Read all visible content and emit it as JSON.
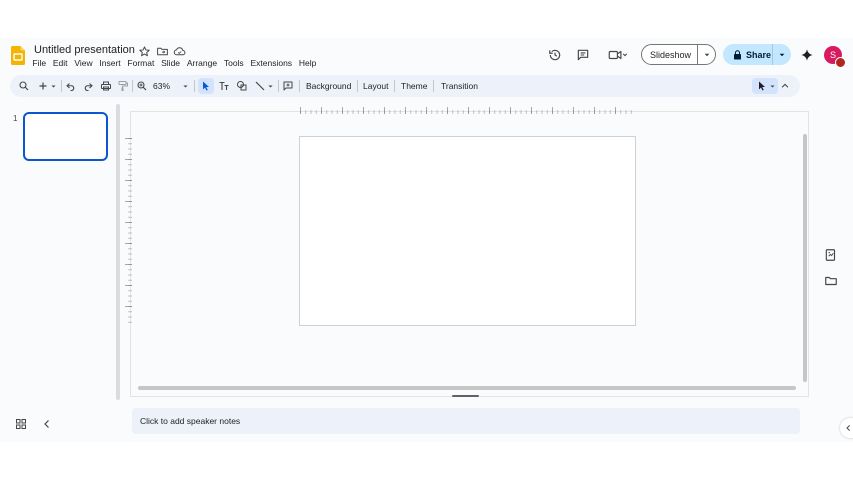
{
  "document": {
    "title": "Untitled presentation"
  },
  "menu": [
    "File",
    "Edit",
    "View",
    "Insert",
    "Format",
    "Slide",
    "Arrange",
    "Tools",
    "Extensions",
    "Help"
  ],
  "header": {
    "slideshow_label": "Slideshow",
    "share_label": "Share",
    "avatar_initial": "S",
    "icons": [
      "history-icon",
      "comment-icon",
      "meet-icon",
      "gemini-icon"
    ]
  },
  "toolbar": {
    "zoom": "63%",
    "background_label": "Background",
    "layout_label": "Layout",
    "theme_label": "Theme",
    "transition_label": "Transition"
  },
  "filmstrip": {
    "slide_numbers": [
      "1"
    ]
  },
  "notes": {
    "placeholder": "Click to add speaker notes"
  },
  "colors": {
    "accent": "#0b57d0",
    "share_bg": "#c2e7ff",
    "toolbar_bg": "#edf2fa",
    "app_bg": "#f9fbfd",
    "avatar": "#d81b60",
    "slides_logo": "#f4b400"
  }
}
